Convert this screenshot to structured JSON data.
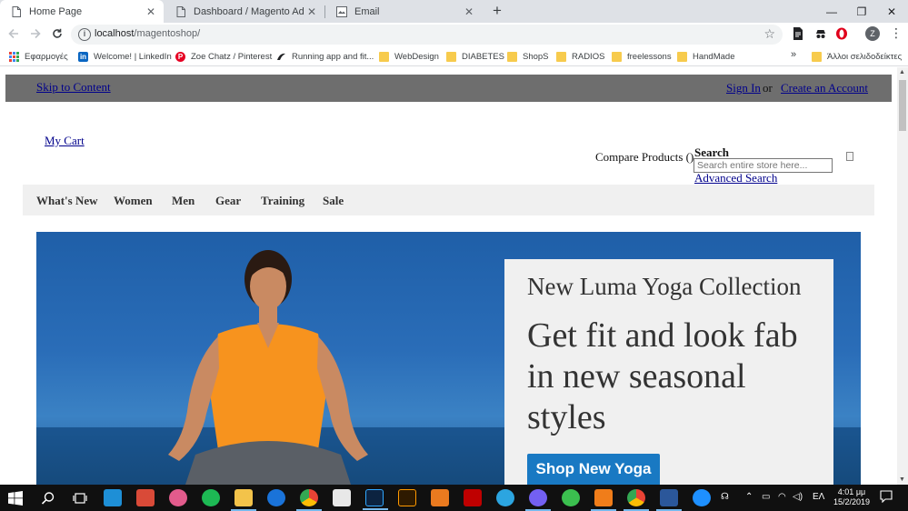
{
  "browser": {
    "tabs": [
      {
        "title": "Home Page",
        "active": true
      },
      {
        "title": "Dashboard / Magento Admin",
        "active": false
      },
      {
        "title": "Email",
        "active": false
      }
    ],
    "tab_close_glyph": "✕",
    "new_tab_glyph": "+",
    "window_controls": {
      "minimize": "—",
      "maximize": "❐",
      "close": "✕"
    },
    "address": {
      "host": "localhost",
      "path": "/magentoshop/"
    },
    "profile_initial": "Z",
    "bookmarks": [
      {
        "label": "Εφαρμογές",
        "icon": "apps-icon"
      },
      {
        "label": "Welcome! | LinkedIn",
        "icon": "linkedin-icon"
      },
      {
        "label": "Zoe Chatz / Pinterest",
        "icon": "pinterest-icon"
      },
      {
        "label": "Running app and fit...",
        "icon": "running-icon"
      },
      {
        "label": "WebDesign",
        "icon": "folder-icon"
      },
      {
        "label": "DIABETES",
        "icon": "folder-icon"
      },
      {
        "label": "ShopS",
        "icon": "folder-icon"
      },
      {
        "label": "RADIOS",
        "icon": "folder-icon"
      },
      {
        "label": "freelessons",
        "icon": "folder-icon"
      },
      {
        "label": "HandMade",
        "icon": "folder-icon"
      }
    ],
    "bookmarks_more": "»",
    "other_bookmarks": "Άλλοι σελιδοδείκτες"
  },
  "site": {
    "skip_link": "Skip to Content",
    "sign_in": "Sign In",
    "or_text": "or",
    "create_account": "Create an Account",
    "my_cart": "My Cart",
    "compare": "Compare Products ()",
    "search_label": "Search",
    "search_placeholder": "Search entire store here...",
    "advanced_search": "Advanced Search",
    "nav": [
      "What's New",
      "Women",
      "Men",
      "Gear",
      "Training",
      "Sale"
    ],
    "hero": {
      "heading": "New Luma Yoga Collection",
      "subheading": "Get fit and look fab in new seasonal styles",
      "cta": "Shop New Yoga"
    }
  },
  "taskbar": {
    "language": "ΕΛ",
    "time": "4:01 μμ",
    "date": "15/2/2019"
  },
  "colors": {
    "accent_blue": "#1979c3",
    "topbar_gray": "#6e6e6e",
    "shirt_orange": "#f7931e"
  }
}
